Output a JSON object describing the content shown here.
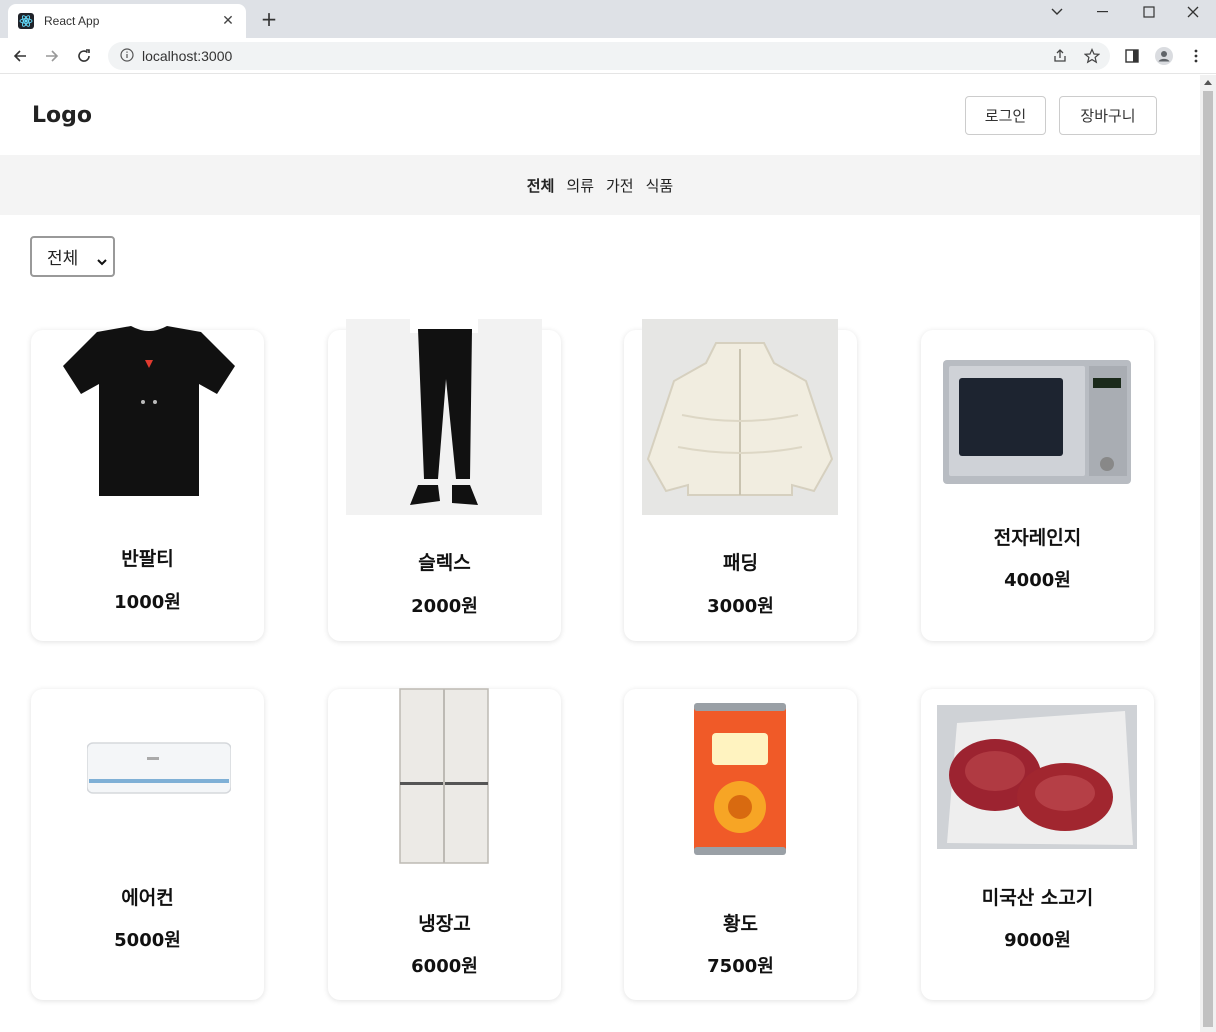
{
  "browser": {
    "tab_title": "React App",
    "url": "localhost:3000"
  },
  "header": {
    "logo": "Logo",
    "login_label": "로그인",
    "cart_label": "장바구니"
  },
  "categories": [
    {
      "label": "전체",
      "active": true
    },
    {
      "label": "의류",
      "active": false
    },
    {
      "label": "가전",
      "active": false
    },
    {
      "label": "식품",
      "active": false
    }
  ],
  "filter": {
    "selected": "전체"
  },
  "products": [
    {
      "name": "반팔티",
      "price": "1000원",
      "icon": "tshirt-image"
    },
    {
      "name": "슬렉스",
      "price": "2000원",
      "icon": "slacks-image"
    },
    {
      "name": "패딩",
      "price": "3000원",
      "icon": "padding-jacket-image"
    },
    {
      "name": "전자레인지",
      "price": "4000원",
      "icon": "microwave-image"
    },
    {
      "name": "에어컨",
      "price": "5000원",
      "icon": "air-conditioner-image"
    },
    {
      "name": "냉장고",
      "price": "6000원",
      "icon": "refrigerator-image"
    },
    {
      "name": "황도",
      "price": "7500원",
      "icon": "canned-peach-image"
    },
    {
      "name": "미국산 소고기",
      "price": "9000원",
      "icon": "beef-image"
    }
  ],
  "colors": {
    "nav_bg": "#f4f4f4",
    "tab_bar": "#dee1e6"
  }
}
